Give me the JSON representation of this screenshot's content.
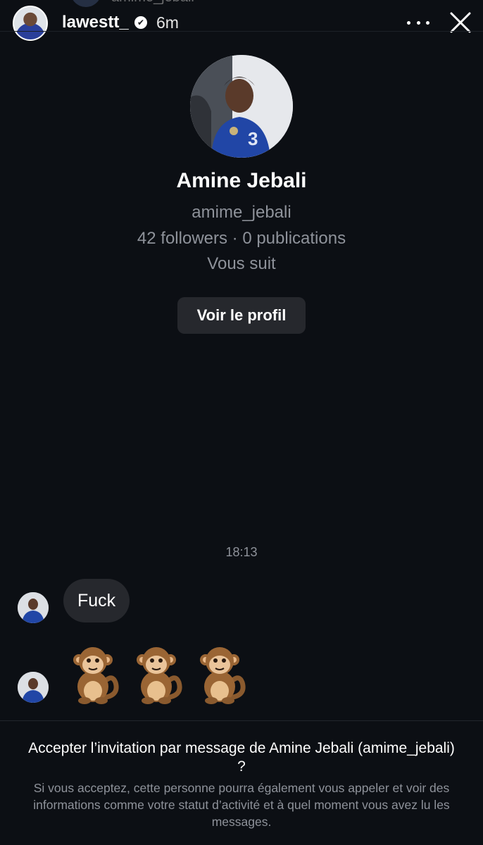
{
  "story_header": {
    "peek_username": "amime_jebali",
    "username": "lawestt_",
    "verified_mark": "✔",
    "time_ago": "6m",
    "more_icon": "ellipsis-icon",
    "close_icon": "close-icon"
  },
  "profile": {
    "name": "Amine Jebali",
    "handle": "amime_jebali",
    "stats": "42 followers · 0 publications",
    "follows_status": "Vous suit",
    "view_profile_label": "Voir le profil"
  },
  "conversation": {
    "timestamp": "18:13",
    "messages": [
      {
        "sender": "amime_jebali",
        "type": "text",
        "text": "Fuck"
      },
      {
        "sender": "amime_jebali",
        "type": "emoji",
        "text": "🐒🐒🐒"
      }
    ]
  },
  "invitation": {
    "question": "Accepter l’invitation par message de Amine Jebali (amime_jebali) ?",
    "note": "Si vous acceptez, cette personne pourra également vous appeler et voir des informations comme votre statut d’activité et à quel moment vous avez lu les messages."
  },
  "colors": {
    "background": "#0c0f14",
    "bubble": "#26282d",
    "secondary_text": "#8e929a",
    "primary_text": "#ffffff"
  }
}
